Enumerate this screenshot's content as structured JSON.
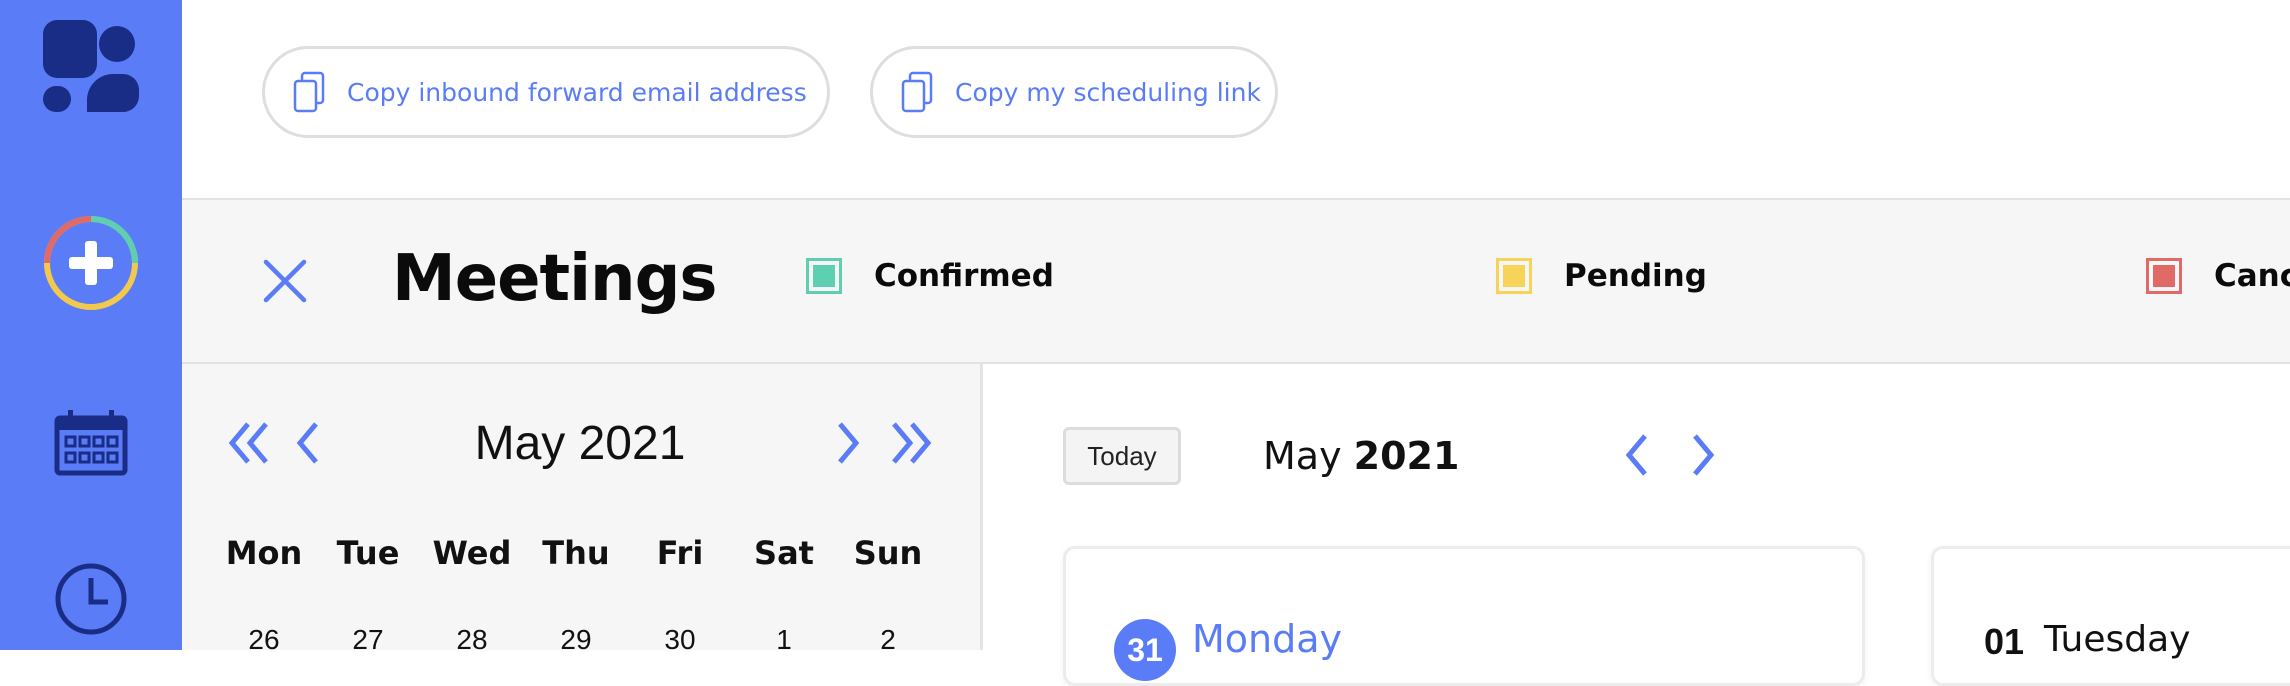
{
  "sidebar": {
    "icons": [
      "logo-icon",
      "add-icon",
      "calendar-icon",
      "clock-icon"
    ]
  },
  "topbar": {
    "copy_email_label": "Copy inbound forward email address",
    "copy_link_label": "Copy my scheduling link"
  },
  "header": {
    "title": "Meetings",
    "legend": [
      {
        "label": "Confirmed",
        "color": "#5ecfb0"
      },
      {
        "label": "Pending",
        "color": "#f7d35a"
      },
      {
        "label": "Canc",
        "color": "#e06b66"
      }
    ]
  },
  "mini_calendar": {
    "month_label": "May 2021",
    "weekdays": [
      "Mon",
      "Tue",
      "Wed",
      "Thu",
      "Fri",
      "Sat",
      "Sun"
    ],
    "first_row": [
      "26",
      "27",
      "28",
      "29",
      "30",
      "1",
      "2"
    ]
  },
  "main": {
    "today_label": "Today",
    "month": "May",
    "year": "2021",
    "days": [
      {
        "num": "31",
        "name": "Monday"
      },
      {
        "num": "01",
        "name": "Tuesday"
      }
    ]
  },
  "colors": {
    "accent": "#5a7cf7"
  }
}
